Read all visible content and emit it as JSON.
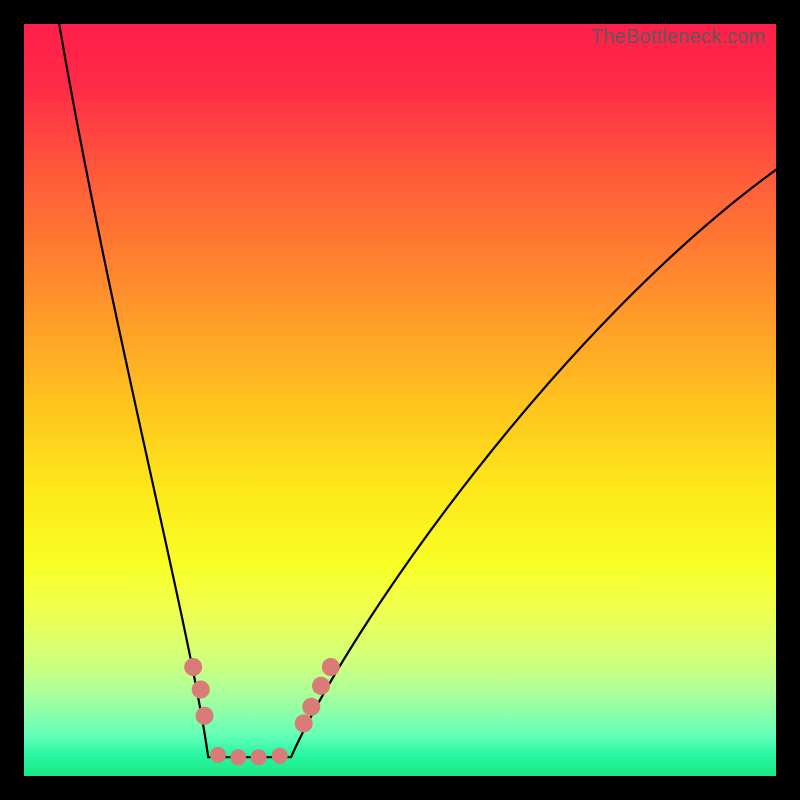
{
  "watermark": "TheBottleneck.com",
  "gradient": {
    "stops": [
      {
        "offset": 0.0,
        "color": "#ff1f4b"
      },
      {
        "offset": 0.08,
        "color": "#ff2a47"
      },
      {
        "offset": 0.2,
        "color": "#ff5a3a"
      },
      {
        "offset": 0.35,
        "color": "#ff8d2d"
      },
      {
        "offset": 0.5,
        "color": "#ffc21f"
      },
      {
        "offset": 0.62,
        "color": "#fde81a"
      },
      {
        "offset": 0.72,
        "color": "#f8ff25"
      },
      {
        "offset": 0.78,
        "color": "#eeff50"
      },
      {
        "offset": 0.85,
        "color": "#cfff7e"
      },
      {
        "offset": 0.9,
        "color": "#a0ffa0"
      },
      {
        "offset": 0.945,
        "color": "#66ffb8"
      },
      {
        "offset": 0.97,
        "color": "#2cf7a3"
      },
      {
        "offset": 1.0,
        "color": "#19e885"
      }
    ]
  },
  "curve": {
    "stroke": "#000000",
    "stroke_width": 2.2,
    "minimum_x_fraction": 0.3,
    "flat_half_width_fraction": 0.055,
    "left_top_x_fraction": 0.045,
    "right_end_fraction": 0.36,
    "bottom_y_fraction": 0.975
  },
  "markers": {
    "fill": "#d97b76",
    "radius": 9,
    "flat_radius": 8,
    "points_fraction": [
      {
        "x": 0.225,
        "y": 0.855
      },
      {
        "x": 0.235,
        "y": 0.885
      },
      {
        "x": 0.24,
        "y": 0.92
      },
      {
        "x": 0.258,
        "y": 0.972
      },
      {
        "x": 0.285,
        "y": 0.975
      },
      {
        "x": 0.312,
        "y": 0.975
      },
      {
        "x": 0.34,
        "y": 0.973
      },
      {
        "x": 0.372,
        "y": 0.93
      },
      {
        "x": 0.382,
        "y": 0.908
      },
      {
        "x": 0.395,
        "y": 0.88
      },
      {
        "x": 0.408,
        "y": 0.855
      }
    ]
  },
  "chart_data": {
    "type": "line",
    "title": "",
    "xlabel": "",
    "ylabel": "",
    "x": [
      0,
      5,
      10,
      15,
      20,
      24,
      27,
      29,
      30,
      31,
      33,
      36,
      40,
      45,
      52,
      60,
      70,
      82,
      95,
      100
    ],
    "values": [
      100,
      82,
      64,
      46,
      28,
      13,
      5,
      1,
      0,
      1,
      4,
      10,
      18,
      27,
      38,
      49,
      60,
      71,
      80,
      83
    ],
    "xlim": [
      0,
      100
    ],
    "ylim": [
      0,
      100
    ],
    "annotations": [
      "TheBottleneck.com"
    ],
    "markers_x": [
      22.5,
      23.5,
      24.0,
      25.8,
      28.5,
      31.2,
      34.0,
      37.2,
      38.2,
      39.5,
      40.8
    ]
  }
}
